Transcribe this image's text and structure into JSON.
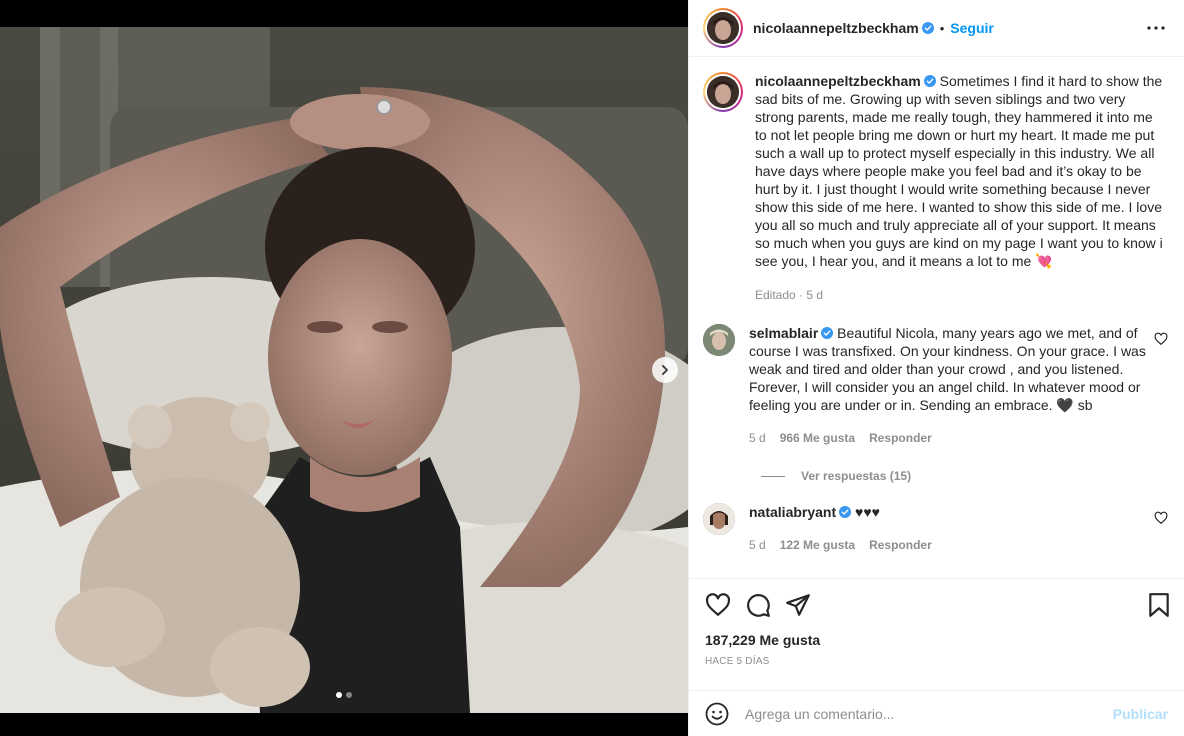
{
  "post": {
    "author": "nicolaannepeltzbeckham",
    "follow_label": "Seguir",
    "separator": "•",
    "more_icon": "more-horizontal-icon",
    "carousel": {
      "current": 1,
      "total": 2
    }
  },
  "caption": {
    "author": "nicolaannepeltzbeckham",
    "text": "Sometimes I find it hard to show the sad bits of me. Growing up with seven siblings and two very strong parents, made me really tough, they hammered it into me to not let people bring me down or hurt my heart. It made me put such a wall up to protect myself especially in this industry. We all have days where people make you feel bad and it’s okay to be hurt by it. I just thought I would write something because I never show this side of me here. I wanted to show this side of me. I love you all so much and truly appreciate all of your support. It means so much when you guys are kind on my page I want you to know i see you, I hear you, and it means a lot to me 💘",
    "meta": "Editado · 5 d"
  },
  "comments": [
    {
      "author": "selmablair",
      "text": "Beautiful Nicola, many years ago we met, and of course I was transfixed. On your kindness. On your grace. I was weak and tired and older than your crowd , and you listened. Forever, I will consider you an angel child. In whatever mood or feeling you are under or in. Sending an embrace. 🖤 sb",
      "time": "5 d",
      "likes": "966 Me gusta",
      "reply": "Responder",
      "view_replies": "Ver respuestas (15)"
    },
    {
      "author": "nataliabryant",
      "text": "♥♥♥",
      "time": "5 d",
      "likes": "122 Me gusta",
      "reply": "Responder"
    }
  ],
  "actions": {
    "likes": "187,229 Me gusta",
    "when": "Hace 5 días"
  },
  "add_comment": {
    "placeholder": "Agrega un comentario...",
    "publish": "Publicar"
  },
  "colors": {
    "accent": "#0095f6",
    "publish_disabled": "#b2dffc",
    "verified": "#3897f0",
    "muted": "#8e8e8e",
    "text": "#262626"
  }
}
